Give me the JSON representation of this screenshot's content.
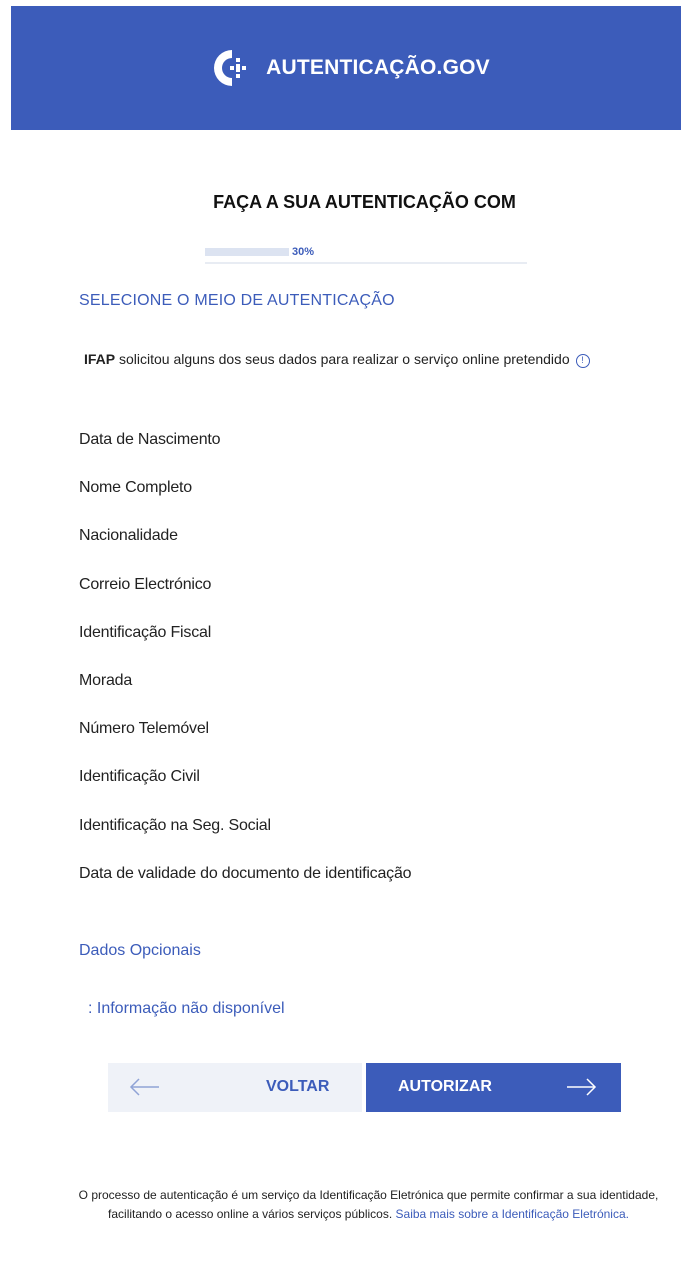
{
  "header": {
    "logo_text": "AUTENTICAÇÃO.GOV",
    "background": "#3c5cba"
  },
  "main": {
    "heading": "FAÇA A SUA AUTENTICAÇÃO COM",
    "progress": {
      "label": "30%",
      "value": 0.3
    },
    "section_title": "SELECIONE O MEIO DE AUTENTICAÇÃO",
    "requester": "IFAP",
    "intro_text": " solicitou alguns dos seus dados para realizar o serviço online pretendido",
    "info_icon": "info-icon",
    "attributes": [
      "Data de Nascimento",
      "Nome Completo",
      "Nacionalidade",
      "Correio Electrónico",
      "Identificação Fiscal",
      "Morada",
      "Número Telemóvel",
      "Identificação Civil",
      "Identificação na Seg. Social",
      "Data de validade do documento de identificação"
    ],
    "optional_title": "Dados Opcionais",
    "optional_info": ": Informação não disponível"
  },
  "actions": {
    "back_label": "VOLTAR",
    "authorize_label": "AUTORIZAR"
  },
  "footer": {
    "line1": "O processo de autenticação é um serviço da Identificação Eletrónica que permite confirmar a sua identidade,",
    "line2": "facilitando o acesso online a vários serviços públicos.",
    "link_text": "Saiba mais sobre a Identificação Eletrónica."
  },
  "colors": {
    "accent": "#3c5cba",
    "back_button_bg": "#eff2f8"
  }
}
